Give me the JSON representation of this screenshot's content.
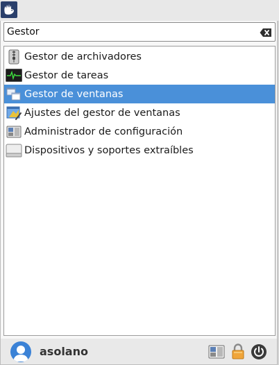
{
  "menu": {
    "search": {
      "value": "Gestor",
      "clear_icon": "backspace-clear-icon"
    },
    "results": [
      {
        "label": "Gestor de archivadores",
        "icon": "archive-manager-icon",
        "selected": false
      },
      {
        "label": "Gestor de tareas",
        "icon": "task-manager-icon",
        "selected": false
      },
      {
        "label": "Gestor de ventanas",
        "icon": "window-manager-icon",
        "selected": true
      },
      {
        "label": "Ajustes del gestor de ventanas",
        "icon": "window-manager-tweaks-icon",
        "selected": false
      },
      {
        "label": "Administrador de configuración",
        "icon": "settings-manager-icon",
        "selected": false
      },
      {
        "label": "Dispositivos y soportes extraíbles",
        "icon": "removable-drive-icon",
        "selected": false
      }
    ],
    "user": {
      "name": "asolano"
    },
    "actions": [
      {
        "icon": "settings-manager-icon"
      },
      {
        "icon": "lock-icon"
      },
      {
        "icon": "power-icon"
      }
    ]
  },
  "colors": {
    "selection": "#4a90d9",
    "topbar_logo_bg": "#2a3f6b",
    "avatar": "#3b82d6"
  }
}
